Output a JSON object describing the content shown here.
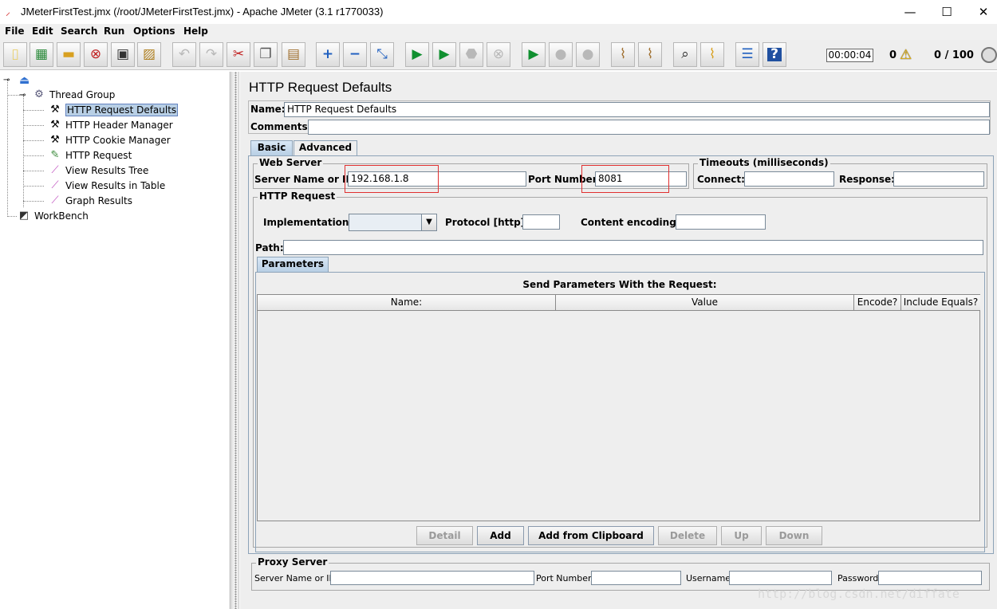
{
  "window": {
    "title": "JMeterFirstTest.jmx (/root/JMeterFirstTest.jmx) - Apache JMeter (3.1 r1770033)",
    "minimize": "—",
    "maximize": "☐",
    "close": "✕"
  },
  "menu": [
    "File",
    "Edit",
    "Search",
    "Run",
    "Options",
    "Help"
  ],
  "toolbar": {
    "icons": [
      "new-icon",
      "templates-icon",
      "open-icon",
      "close-icon",
      "save-icon",
      "save-as-icon",
      "undo-icon",
      "redo-icon",
      "cut-icon",
      "copy-icon",
      "paste-icon",
      "expand-icon",
      "collapse-icon",
      "toggle-icon",
      "start-icon",
      "start-no-timers-icon",
      "stop-icon",
      "shutdown-icon",
      "remote-start-icon",
      "remote-stop-icon",
      "remote-shutdown-icon",
      "clear-icon",
      "clear-all-icon",
      "search-icon",
      "reset-search-icon",
      "function-helper-icon",
      "help-icon"
    ],
    "timer": "00:00:04",
    "error_count": "0",
    "threads": "0 / 100"
  },
  "tree": {
    "root_icon": "test-plan-icon",
    "thread_group": "Thread Group",
    "items": [
      {
        "label": "HTTP Request Defaults",
        "icon": "wrench-icon",
        "selected": true
      },
      {
        "label": "HTTP Header Manager",
        "icon": "wrench-icon"
      },
      {
        "label": "HTTP Cookie Manager",
        "icon": "wrench-icon"
      },
      {
        "label": "HTTP Request",
        "icon": "pipette-icon"
      },
      {
        "label": "View Results Tree",
        "icon": "chart-icon"
      },
      {
        "label": "View Results in Table",
        "icon": "chart-icon"
      },
      {
        "label": "Graph Results",
        "icon": "chart-icon"
      }
    ],
    "workbench": "WorkBench"
  },
  "panel": {
    "title": "HTTP Request Defaults",
    "name_label": "Name:",
    "name_value": "HTTP Request Defaults",
    "comments_label": "Comments:",
    "comments_value": "",
    "tabs": [
      "Basic",
      "Advanced"
    ],
    "web_server": {
      "title": "Web Server",
      "server_label": "Server Name or IP:",
      "server_value": "192.168.1.8",
      "port_label": "Port Number:",
      "port_value": "8081"
    },
    "timeouts": {
      "title": "Timeouts (milliseconds)",
      "connect_label": "Connect:",
      "connect_value": "",
      "response_label": "Response:",
      "response_value": ""
    },
    "http_request": {
      "title": "HTTP Request",
      "impl_label": "Implementation:",
      "impl_value": "",
      "protocol_label": "Protocol [http]:",
      "protocol_value": "",
      "encoding_label": "Content encoding:",
      "encoding_value": "",
      "path_label": "Path:",
      "path_value": ""
    },
    "parameters": {
      "tab": "Parameters",
      "heading": "Send Parameters With the Request:",
      "columns": [
        "Name:",
        "Value",
        "Encode?",
        "Include Equals?"
      ],
      "buttons": [
        "Detail",
        "Add",
        "Add from Clipboard",
        "Delete",
        "Up",
        "Down"
      ]
    },
    "proxy": {
      "title": "Proxy Server",
      "server_label": "Server Name or IP:",
      "port_label": "Port Number:",
      "username_label": "Username",
      "password_label": "Password"
    }
  },
  "watermark": "http://blog.csdn.net/diffate"
}
